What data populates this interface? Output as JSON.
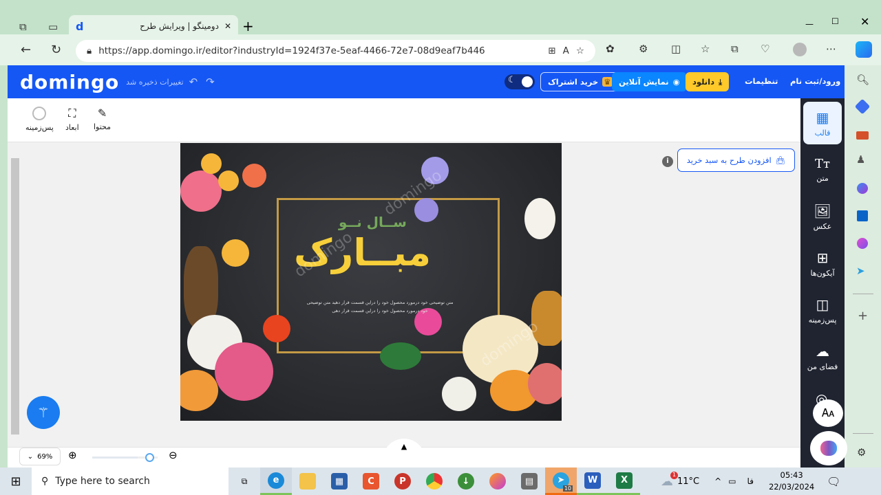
{
  "browser": {
    "tab_title": "دومینگو | ویرایش طرح",
    "url": "https://app.domingo.ir/editor?industryId=1924f37e-5eaf-4466-72e7-08d9eaf7b446"
  },
  "header": {
    "logo": "domingo",
    "saved_status": "تغییرات ذخیره شد",
    "login": "ورود/ثبت نام",
    "settings": "تنظیمات",
    "download": "دانلود",
    "online_view": "نمایش آنلاین",
    "subscribe": "خرید اشتراک"
  },
  "toolbar": {
    "content": "محتوا",
    "dimensions": "ابعاد",
    "background": "پس‌زمینه"
  },
  "cart_button": "افزودن طرح به سبد خرید",
  "design": {
    "title_small": "ســال نــو",
    "title_big": "مبــارک",
    "desc_1": "متن توضیحی خود درمورد محصول خود را دراین قسمت قرار دهید متن توضیحی",
    "desc_2": "خود درمورد محصول خود را دراین قسمت قرار دهی",
    "watermark": "domingo"
  },
  "sidebar": {
    "items": [
      {
        "label": "قالب",
        "icon": "template-icon"
      },
      {
        "label": "متن",
        "icon": "text-icon"
      },
      {
        "label": "عکس",
        "icon": "image-icon"
      },
      {
        "label": "آیکون‌ها",
        "icon": "grid-icon"
      },
      {
        "label": "پس‌زمینه",
        "icon": "background-icon"
      },
      {
        "label": "فضای من",
        "icon": "cloud-upload-icon"
      }
    ]
  },
  "zoom": {
    "level": "69%",
    "value": 69
  },
  "taskbar": {
    "search_placeholder": "Type here to search",
    "weather": "11°C",
    "weather_badge": "1",
    "telegram_badge": "10",
    "lang": "فا",
    "time": "05:43",
    "date": "22/03/2024"
  },
  "colors": {
    "brand": "#1557f5",
    "download": "#ffc929",
    "sidebar": "#1f2430"
  }
}
